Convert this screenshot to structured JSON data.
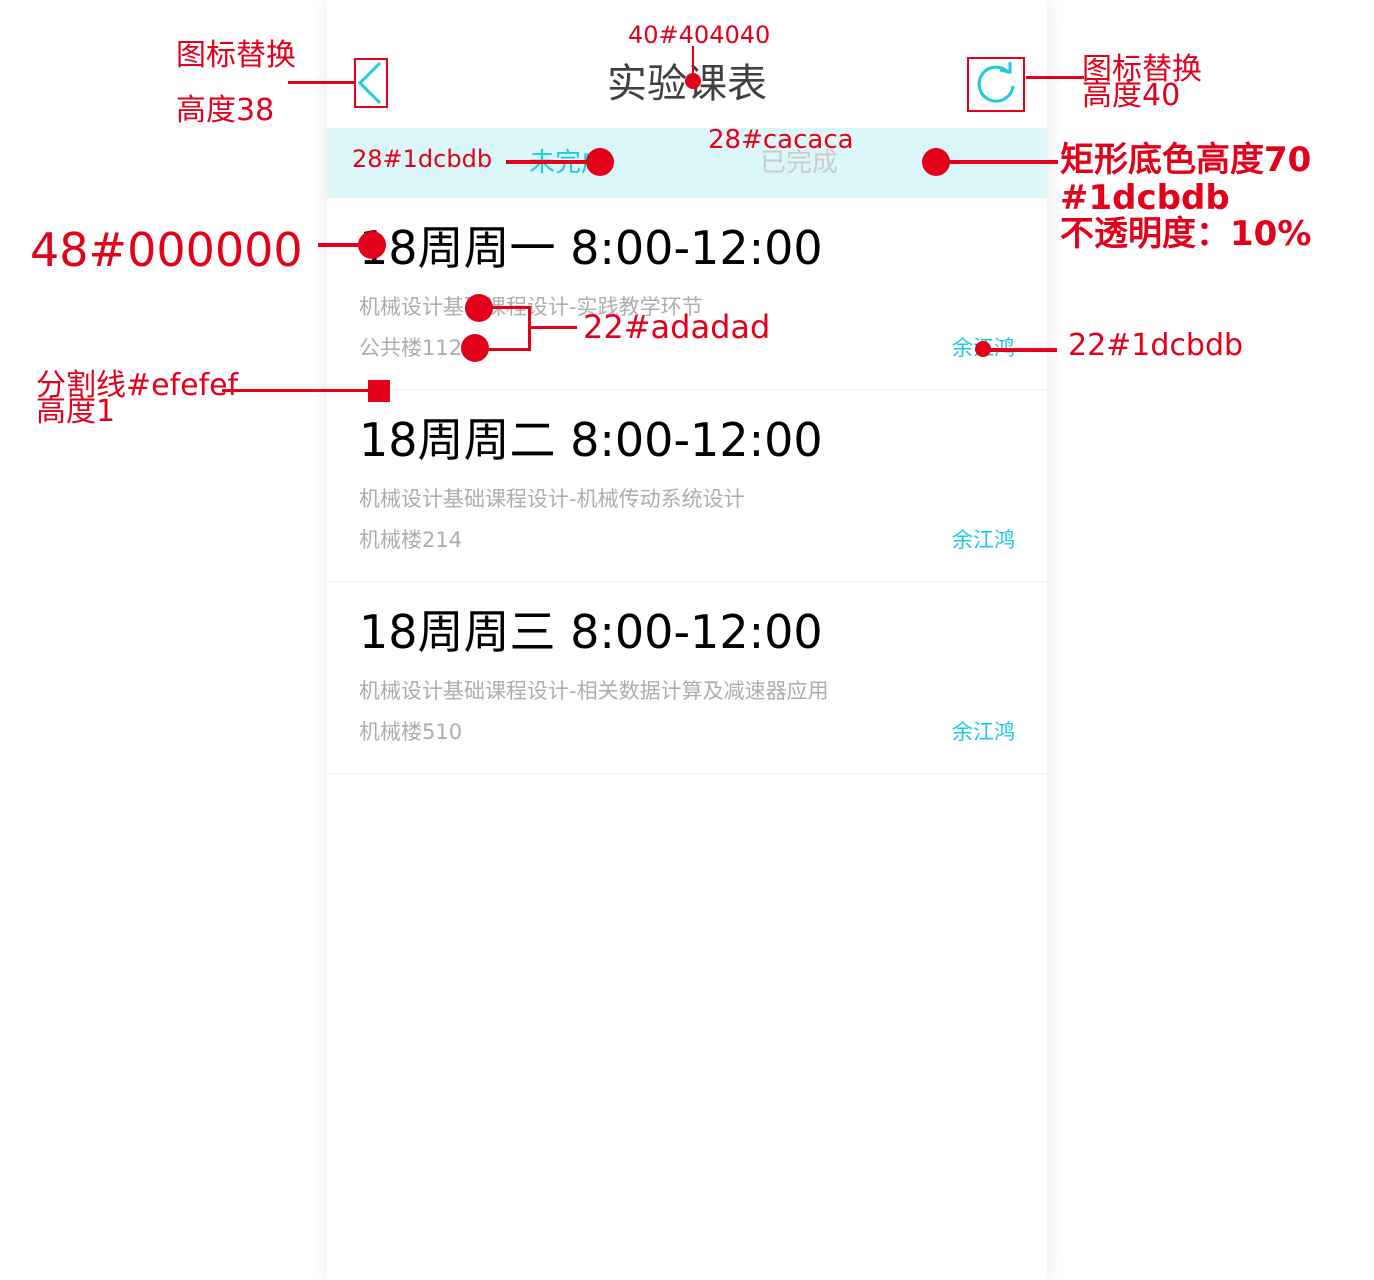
{
  "navbar": {
    "title": "实验课表",
    "back_icon": "chevron-left-icon",
    "refresh_icon": "refresh-icon"
  },
  "tabs": [
    {
      "label": "未完成",
      "selected": true,
      "color": "#1dcbdb"
    },
    {
      "label": "已完成",
      "selected": false,
      "color": "#cacaca"
    }
  ],
  "schedule": [
    {
      "time": "18周周一 8:00-12:00",
      "course": "机械设计基础课程设计-实践教学环节",
      "room": "公共楼112",
      "teacher": "余江鸿"
    },
    {
      "time": "18周周二 8:00-12:00",
      "course": "机械设计基础课程设计-机械传动系统设计",
      "room": "机械楼214",
      "teacher": "余江鸿"
    },
    {
      "time": "18周周三 8:00-12:00",
      "course": "机械设计基础课程设计-相关数据计算及减速器应用",
      "room": "机械楼510",
      "teacher": "余江鸿"
    }
  ],
  "annotations": {
    "back_icon_note_1": "图标替换",
    "back_icon_note_2": "高度38",
    "title_spec": "40#404040",
    "refresh_icon_note_1": "图标替换",
    "refresh_icon_note_2": "高度40",
    "tab_active_spec": "28#1dcbdb",
    "tab_inactive_spec": "28#cacaca",
    "tabbar_note_1": "矩形底色高度70",
    "tabbar_note_2": "#1dcbdb",
    "tabbar_note_3": "不透明度：10%",
    "time_spec": "48#000000",
    "subtext_spec": "22#adadad",
    "teacher_spec": "22#1dcbdb",
    "divider_note_1": "分割线#efefef",
    "divider_note_2": "高度1"
  },
  "colors": {
    "accent": "#1dcbdb",
    "title": "#404040",
    "subtext": "#adadad",
    "inactive": "#cacaca",
    "divider": "#efefef",
    "annotation": "#e3001b"
  }
}
